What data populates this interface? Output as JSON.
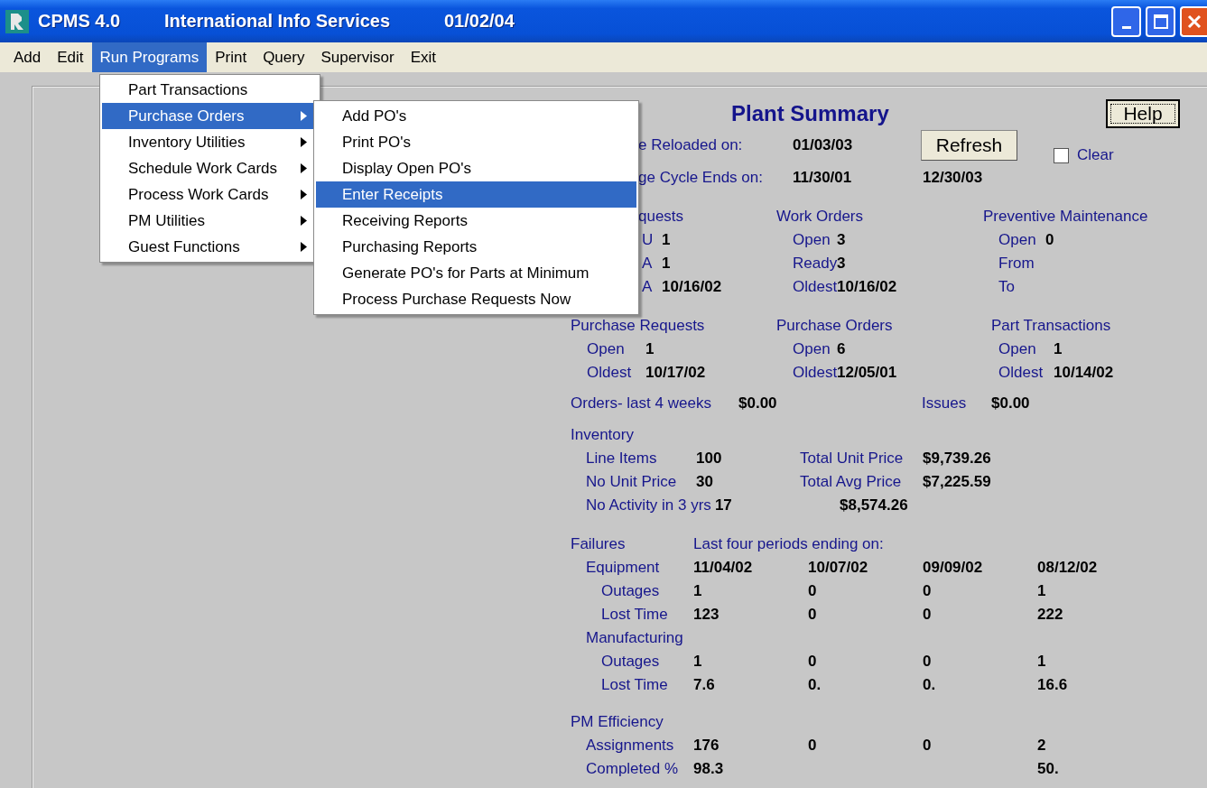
{
  "window": {
    "title": [
      "CPMS 4.0",
      "International Info Services",
      "01/02/04"
    ]
  },
  "menu_bar": [
    {
      "label": "Add",
      "selected": false
    },
    {
      "label": "Edit",
      "selected": false
    },
    {
      "label": "Run Programs",
      "selected": true
    },
    {
      "label": "Print",
      "selected": false
    },
    {
      "label": "Query",
      "selected": false
    },
    {
      "label": "Supervisor",
      "selected": false
    },
    {
      "label": "Exit",
      "selected": false
    }
  ],
  "dropdown": {
    "items": [
      {
        "label": "Part Transactions",
        "has_submenu": false,
        "selected": false
      },
      {
        "label": "Purchase Orders",
        "has_submenu": true,
        "selected": true
      },
      {
        "label": "Inventory Utilities",
        "has_submenu": true,
        "selected": false
      },
      {
        "label": "Schedule Work Cards",
        "has_submenu": true,
        "selected": false
      },
      {
        "label": "Process Work Cards",
        "has_submenu": true,
        "selected": false
      },
      {
        "label": "PM Utilities",
        "has_submenu": true,
        "selected": false
      },
      {
        "label": "Guest Functions",
        "has_submenu": true,
        "selected": false
      }
    ]
  },
  "submenu": {
    "items": [
      {
        "label": "Add PO's",
        "selected": false
      },
      {
        "label": "Print PO's",
        "selected": false
      },
      {
        "label": "Display Open PO's",
        "selected": false
      },
      {
        "label": "Enter Receipts",
        "selected": true
      },
      {
        "label": "Receiving Reports",
        "selected": false
      },
      {
        "label": "Purchasing Reports",
        "selected": false
      },
      {
        "label": "Generate PO's for Parts at Minimum",
        "selected": false
      },
      {
        "label": "Process Purchase Requests Now",
        "selected": false
      }
    ]
  },
  "summary": {
    "title": "Plant Summary",
    "help_button": "Help",
    "refresh_button": "Refresh",
    "clear_checkbox": {
      "label": "Clear",
      "checked": false
    },
    "reloaded": {
      "label": "e Reloaded on:",
      "values": [
        "01/03/03"
      ]
    },
    "cycle": {
      "label": "ge Cycle Ends on:",
      "values": [
        "11/30/01",
        "12/30/03"
      ]
    },
    "group_rows": [
      [
        {
          "heading": "quests",
          "rows": [
            {
              "label": "U",
              "value": "1"
            },
            {
              "label": "A",
              "value": "1"
            },
            {
              "label": "A",
              "value": "10/16/02"
            }
          ]
        },
        {
          "heading": "Work Orders",
          "rows": [
            {
              "label": "Open",
              "value": "3"
            },
            {
              "label": "Ready",
              "value": "3"
            },
            {
              "label": "Oldest",
              "value": "10/16/02"
            }
          ]
        },
        {
          "heading": "Preventive Maintenance",
          "rows": [
            {
              "label": "Open",
              "value": "0"
            },
            {
              "label": "From"
            },
            {
              "label": "To"
            }
          ]
        }
      ],
      [
        {
          "heading": "Purchase Requests",
          "rows": [
            {
              "label": "Open",
              "value": "1"
            },
            {
              "label": "Oldest",
              "value": "10/17/02"
            }
          ]
        },
        {
          "heading": "Purchase Orders",
          "rows": [
            {
              "label": "Open",
              "value": "6"
            },
            {
              "label": "Oldest",
              "value": "12/05/01"
            }
          ]
        },
        {
          "heading": "Part Transactions",
          "rows": [
            {
              "label": "Open",
              "value": "1"
            },
            {
              "label": "Oldest",
              "value": "10/14/02"
            }
          ]
        }
      ]
    ],
    "totals": [
      {
        "label": "Orders- last 4 weeks",
        "value": "$0.00"
      },
      {
        "label": "Issues",
        "value": "$0.00"
      }
    ],
    "inventory": {
      "heading": "Inventory",
      "rows": [
        {
          "label": "Line Items",
          "value": "100",
          "total_label": "Total Unit Price",
          "total_value": "$9,739.26"
        },
        {
          "label": "No Unit Price",
          "value": "30",
          "total_label": "Total Avg Price",
          "total_value": "$7,225.59"
        },
        {
          "label": "No Activity in 3 yrs",
          "value": "17",
          "total_value": "$8,574.26"
        }
      ]
    },
    "failures": {
      "heading": "Failures",
      "subheading": "Last four periods ending on:",
      "groups": [
        {
          "label": "Equipment",
          "values": [
            "11/04/02",
            "10/07/02",
            "09/09/02",
            "08/12/02"
          ],
          "children": [
            {
              "label": "Outages",
              "values": [
                "1",
                "0",
                "0",
                "1"
              ]
            },
            {
              "label": "Lost Time",
              "values": [
                "123",
                "0",
                "0",
                "222"
              ]
            }
          ]
        },
        {
          "label": "Manufacturing",
          "children": [
            {
              "label": "Outages",
              "values": [
                "1",
                "0",
                "0",
                "1"
              ]
            },
            {
              "label": "Lost Time",
              "values": [
                "7.6",
                "0.",
                "0.",
                "16.6"
              ]
            }
          ]
        }
      ]
    },
    "pm_efficiency": {
      "heading": "PM Efficiency",
      "rows": [
        {
          "label": "Assignments",
          "period_1": "176",
          "period_2": "0",
          "period_3": "0",
          "period_4": "2"
        },
        {
          "label": "Completed %",
          "period_1": "98.3",
          "period_4": "50."
        }
      ]
    }
  }
}
